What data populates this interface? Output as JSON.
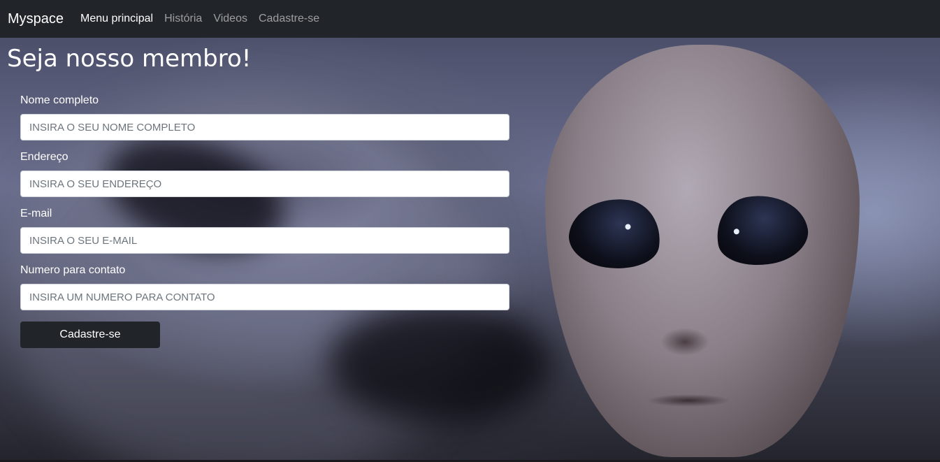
{
  "navbar": {
    "brand": "Myspace",
    "links": [
      {
        "label": "Menu principal",
        "active": true
      },
      {
        "label": "História",
        "active": false
      },
      {
        "label": "Videos",
        "active": false
      },
      {
        "label": "Cadastre-se",
        "active": false
      }
    ]
  },
  "page": {
    "title": "Seja nosso membro!"
  },
  "form": {
    "fields": [
      {
        "label": "Nome completo",
        "placeholder": "INSIRA O SEU NOME COMPLETO",
        "value": ""
      },
      {
        "label": "Endereço",
        "placeholder": "INSIRA O SEU ENDEREÇO",
        "value": ""
      },
      {
        "label": "E-mail",
        "placeholder": "INSIRA O SEU E-MAIL",
        "value": ""
      },
      {
        "label": "Numero para contato",
        "placeholder": "INSIRA UM NUMERO PARA CONTATO",
        "value": ""
      }
    ],
    "submit_label": "Cadastre-se"
  },
  "colors": {
    "navbar_bg": "#212529",
    "button_bg": "#212529",
    "nav_inactive": "rgba(255,255,255,0.55)"
  }
}
